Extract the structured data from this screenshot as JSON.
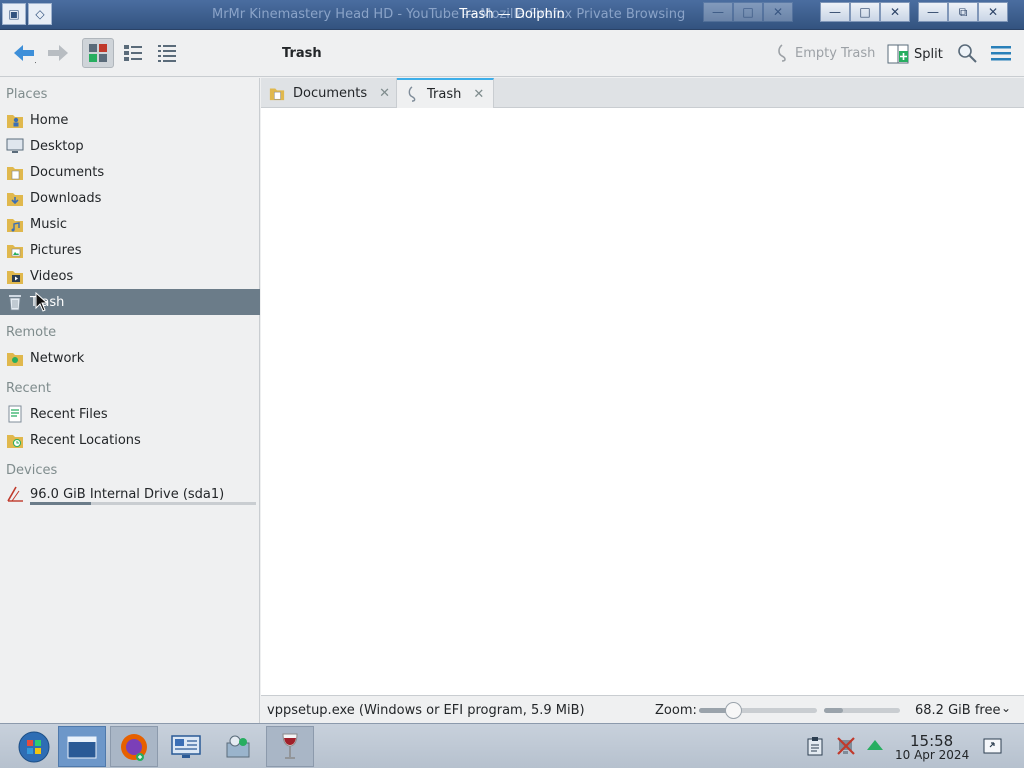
{
  "window": {
    "background_title": "MrMr Kinemastery Head HD - YouTube — Mozilla Firefox Private Browsing",
    "title": "Trash — Dolphin"
  },
  "toolbar": {
    "location_label": "Trash",
    "empty_trash_label": "Empty Trash",
    "split_label": "Split"
  },
  "sidebar": {
    "places_title": "Places",
    "places": [
      {
        "label": "Home",
        "icon": "home-folder-icon"
      },
      {
        "label": "Desktop",
        "icon": "desktop-icon"
      },
      {
        "label": "Documents",
        "icon": "documents-folder-icon"
      },
      {
        "label": "Downloads",
        "icon": "downloads-folder-icon"
      },
      {
        "label": "Music",
        "icon": "music-folder-icon"
      },
      {
        "label": "Pictures",
        "icon": "pictures-folder-icon"
      },
      {
        "label": "Videos",
        "icon": "videos-folder-icon"
      },
      {
        "label": "Trash",
        "icon": "trash-icon",
        "selected": true
      }
    ],
    "remote_title": "Remote",
    "remote": [
      {
        "label": "Network",
        "icon": "network-folder-icon"
      }
    ],
    "recent_title": "Recent",
    "recent": [
      {
        "label": "Recent Files",
        "icon": "recent-files-icon"
      },
      {
        "label": "Recent Locations",
        "icon": "recent-locations-icon"
      }
    ],
    "devices_title": "Devices",
    "devices": [
      {
        "label": "96.0 GiB Internal Drive (sda1)",
        "icon": "drive-icon",
        "usage_fraction": 0.27
      }
    ]
  },
  "tabs": [
    {
      "label": "Documents",
      "active": false
    },
    {
      "label": "Trash",
      "active": true
    }
  ],
  "statusbar": {
    "selection_text": "vppsetup.exe (Windows or EFI program, 5.9 MiB)",
    "zoom_label": "Zoom:",
    "zoom_fraction": 0.29,
    "space_used_fraction": 0.25,
    "free_label": "68.2 GiB free"
  },
  "taskbar": {
    "clock_time": "15:58",
    "clock_date": "10 Apr 2024"
  },
  "colors": {
    "titlebar": "#33537f",
    "selection": "#6b7c89",
    "accent": "#3daee9"
  }
}
